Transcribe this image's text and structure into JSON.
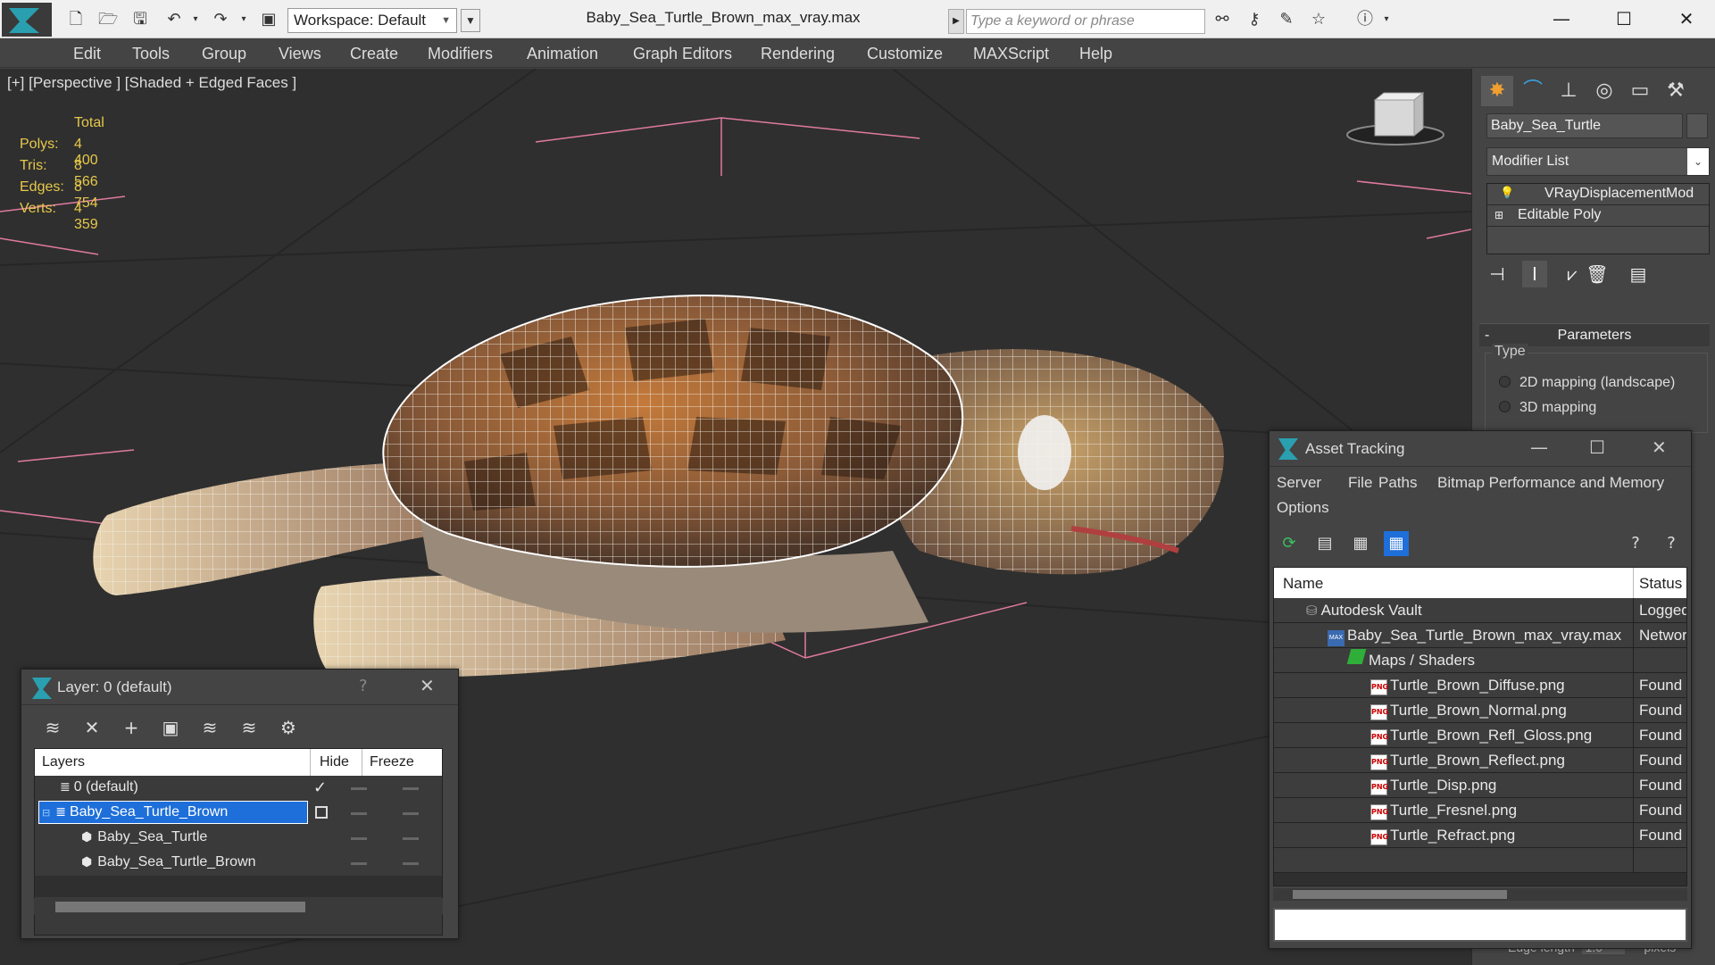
{
  "window": {
    "title": "Baby_Sea_Turtle_Brown_max_vray.max",
    "workspace": "Workspace: Default",
    "search_placeholder": "Type a keyword or phrase"
  },
  "menu": [
    "Edit",
    "Tools",
    "Group",
    "Views",
    "Create",
    "Modifiers",
    "Animation",
    "Graph Editors",
    "Rendering",
    "Customize",
    "MAXScript",
    "Help"
  ],
  "viewport": {
    "label": "[+] [Perspective ] [Shaded + Edged Faces ]",
    "stats": {
      "header": "Total",
      "rows": [
        {
          "label": "Polys:",
          "value": "4 400"
        },
        {
          "label": "Tris:",
          "value": "8 566"
        },
        {
          "label": "Edges:",
          "value": "8 754"
        },
        {
          "label": "Verts:",
          "value": "4 359"
        }
      ]
    }
  },
  "command_panel": {
    "object_name": "Baby_Sea_Turtle",
    "modifier_list": "Modifier List",
    "stack": [
      "VRayDisplacementMod",
      "Editable Poly"
    ],
    "parameters_title": "Parameters",
    "type_label": "Type",
    "type_options": [
      "2D mapping (landscape)",
      "3D mapping"
    ],
    "edge_length_label": "Edge length",
    "edge_length_value": "1.0",
    "edge_length_unit": "pixels"
  },
  "asset_tracking": {
    "title": "Asset Tracking",
    "menus": [
      "Server",
      "File",
      "Paths",
      "Bitmap Performance and Memory",
      "Options"
    ],
    "columns": {
      "name": "Name",
      "status": "Status"
    },
    "rows": [
      {
        "name": "Autodesk Vault",
        "status": "Logged",
        "icon": "vault-icon"
      },
      {
        "name": "Baby_Sea_Turtle_Brown_max_vray.max",
        "status": "Networ",
        "icon": "max-file-icon"
      },
      {
        "name": "Maps / Shaders",
        "status": "",
        "icon": "maps-icon"
      },
      {
        "name": "Turtle_Brown_Diffuse.png",
        "status": "Found",
        "icon": "png-icon"
      },
      {
        "name": "Turtle_Brown_Normal.png",
        "status": "Found",
        "icon": "png-icon"
      },
      {
        "name": "Turtle_Brown_Refl_Gloss.png",
        "status": "Found",
        "icon": "png-icon"
      },
      {
        "name": "Turtle_Brown_Reflect.png",
        "status": "Found",
        "icon": "png-icon"
      },
      {
        "name": "Turtle_Disp.png",
        "status": "Found",
        "icon": "png-icon"
      },
      {
        "name": "Turtle_Fresnel.png",
        "status": "Found",
        "icon": "png-icon"
      },
      {
        "name": "Turtle_Refract.png",
        "status": "Found",
        "icon": "png-icon"
      }
    ]
  },
  "layer_dialog": {
    "title": "Layer: 0 (default)",
    "help": "?",
    "columns": {
      "layers": "Layers",
      "hide": "Hide",
      "freeze": "Freeze"
    },
    "rows": [
      {
        "name": "0 (default)",
        "active": true
      },
      {
        "name": "Baby_Sea_Turtle_Brown",
        "selected": true
      },
      {
        "name": "Baby_Sea_Turtle"
      },
      {
        "name": "Baby_Sea_Turtle_Brown"
      }
    ]
  },
  "colors": {
    "accent": "#2a9fb0",
    "stats_yellow": "#e6c84a",
    "selection_blue": "#1e6fd9",
    "grid_pink": "#e07aa0"
  }
}
